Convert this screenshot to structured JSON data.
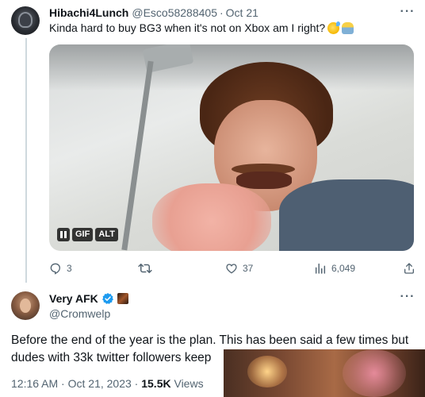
{
  "tweet1": {
    "display_name": "Hibachi4Lunch",
    "handle": "@Esco58288405",
    "separator": "·",
    "date": "Oct 21",
    "text": "Kinda hard to buy BG3 when it's not on Xbox am I right?",
    "emojis": [
      "sweat-smile-emoji",
      "person-shrugging-emoji"
    ],
    "media": {
      "type": "gif",
      "controls": {
        "gif_label": "GIF",
        "alt_label": "ALT"
      }
    },
    "actions": {
      "replies": "3",
      "retweets": "",
      "likes": "37",
      "views": "6,049"
    }
  },
  "tweet2": {
    "display_name": "Very AFK",
    "handle": "@Cromwelp",
    "text": "Before the end of the year is the plan. This has been said a few times but dudes with 33k twitter followers keep",
    "time": "12:16 AM",
    "separator": "·",
    "date": "Oct 21, 2023",
    "views_count": "15.5K",
    "views_label": "Views"
  },
  "colors": {
    "text_primary": "#0f1419",
    "text_secondary": "#536471",
    "verified_blue": "#1d9bf0",
    "thread_line": "#cfd9de"
  },
  "icons": [
    "more-icon",
    "reply-icon",
    "retweet-icon",
    "like-icon",
    "views-icon",
    "share-icon",
    "verified-icon",
    "pause-icon"
  ]
}
